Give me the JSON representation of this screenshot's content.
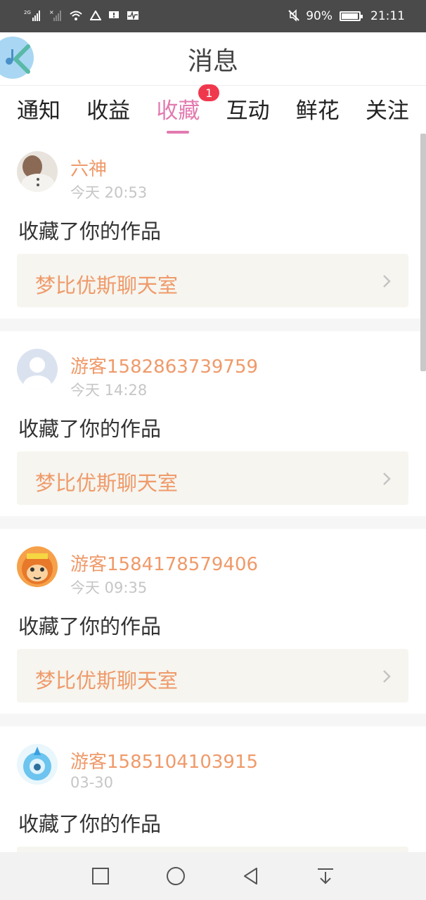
{
  "status_bar": {
    "network_2g": "2G",
    "battery": "90%",
    "time": "21:11"
  },
  "header": {
    "title": "消息",
    "back_icon": "chevron-left-icon"
  },
  "tabs": [
    {
      "label": "通知",
      "active": false
    },
    {
      "label": "收益",
      "active": false
    },
    {
      "label": "收藏",
      "active": true,
      "badge": "1"
    },
    {
      "label": "互动",
      "active": false
    },
    {
      "label": "鲜花",
      "active": false
    },
    {
      "label": "关注",
      "active": false
    }
  ],
  "items": [
    {
      "user": "六神",
      "time": "今天 20:53",
      "action": "收藏了你的作品",
      "work": "梦比优斯聊天室",
      "avatar": "photo"
    },
    {
      "user": "游客1582863739759",
      "time": "今天 14:28",
      "action": "收藏了你的作品",
      "work": "梦比优斯聊天室",
      "avatar": "default"
    },
    {
      "user": "游客1584178579406",
      "time": "今天 09:35",
      "action": "收藏了你的作品",
      "work": "梦比优斯聊天室",
      "avatar": "monkey"
    },
    {
      "user": "游客1585104103915",
      "time": "03-30",
      "action": "收藏了你的作品",
      "work": "",
      "avatar": "crystal"
    }
  ],
  "colors": {
    "accent": "#e27ab0",
    "username": "#ef9a6a",
    "badge": "#f0384d",
    "link_bg": "#f6f5ef"
  }
}
